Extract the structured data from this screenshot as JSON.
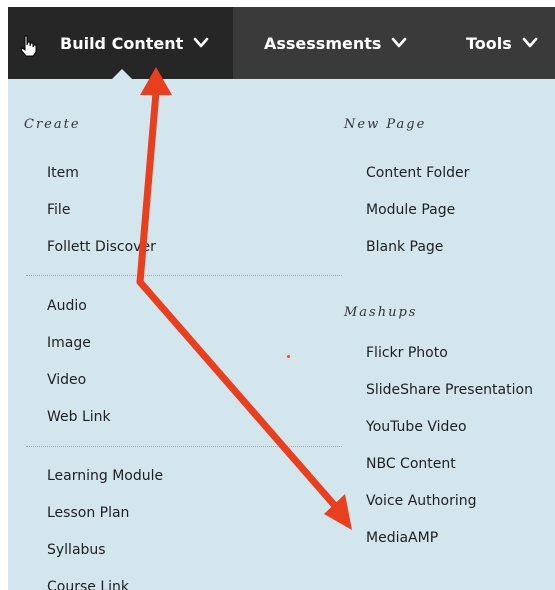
{
  "menubar": {
    "items": [
      {
        "label": "Build Content",
        "icon": "chevron-down-icon",
        "active": true
      },
      {
        "label": "Assessments",
        "icon": "chevron-down-icon",
        "active": false
      },
      {
        "label": "Tools",
        "icon": "chevron-down-icon",
        "active": false
      }
    ],
    "cursor_icon": "hand-pointer-icon"
  },
  "dropdown": {
    "left": {
      "title": "Create",
      "groups": [
        [
          "Item",
          "File",
          "Follett Discover"
        ],
        [
          "Audio",
          "Image",
          "Video",
          "Web Link"
        ],
        [
          "Learning Module",
          "Lesson Plan",
          "Syllabus",
          "Course Link"
        ]
      ]
    },
    "right": {
      "new_page_title": "New Page",
      "new_page_items": [
        "Content Folder",
        "Module Page",
        "Blank Page"
      ],
      "mashups_title": "Mashups",
      "mashups_items": [
        "Flickr Photo",
        "SlideShare Presentation",
        "YouTube Video",
        "NBC Content",
        "Voice Authoring",
        "MediaAMP"
      ]
    }
  },
  "annotation": {
    "arrow_color": "#e8401f",
    "description_icon": "red-arrow-annotation"
  },
  "colors": {
    "menubar_bg": "#3a3a3a",
    "menubar_active_bg": "#262626",
    "panel_bg": "#d3e6ee",
    "text": "#1f1f1f"
  }
}
